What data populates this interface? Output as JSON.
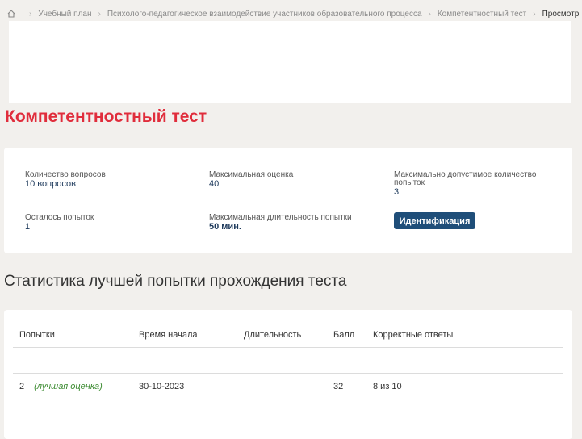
{
  "breadcrumb": {
    "items": [
      "Учебный план",
      "Психолого-педагогическое взаимодействие участников образовательного процесса",
      "Компетентностный тест",
      "Просмотр"
    ]
  },
  "page": {
    "title": "Компетентностный тест"
  },
  "info": {
    "questions_label": "Количество вопросов",
    "questions_value": "10 вопросов",
    "max_score_label": "Максимальная оценка",
    "max_score_value": "40",
    "max_attempts_label": "Максимально допустимое количество попыток",
    "max_attempts_value": "3",
    "remaining_label": "Осталось попыток",
    "remaining_value": "1",
    "max_duration_label": "Максимальная длительность попытки",
    "max_duration_value": "50 мин.",
    "identify_button": "Идентификация"
  },
  "stats": {
    "title": "Статистика лучшей попытки прохождения теста",
    "columns": [
      "Попытки",
      "Время начала",
      "Длительность",
      "Балл",
      "Корректные ответы"
    ],
    "rows": [
      {
        "attempt": "2",
        "best_label": "(лучшая оценка)",
        "start": "30-10-2023",
        "duration": "",
        "score": "32",
        "correct": "8 из 10"
      }
    ]
  },
  "colors": {
    "accent_red": "#e02d3c",
    "button_blue": "#1f4e79",
    "best_green": "#3a8a2f"
  },
  "icons": {
    "home": "home-icon",
    "separator": "chevron-right-icon"
  }
}
